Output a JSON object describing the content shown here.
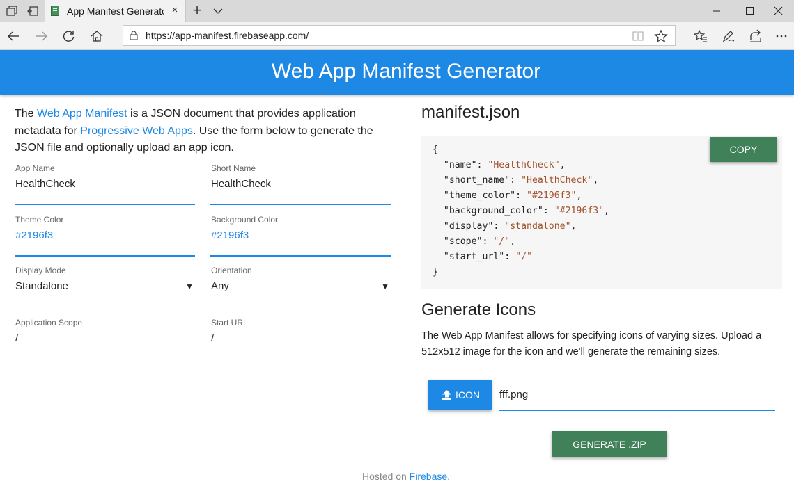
{
  "browser": {
    "tab_title": "App Manifest Generator",
    "url": "https://app-manifest.firebaseapp.com/",
    "new_tab_label": "+",
    "close_tab_label": "×"
  },
  "header": {
    "title": "Web App Manifest Generator"
  },
  "intro": {
    "t1": "The ",
    "link1": "Web App Manifest",
    "t2": " is a JSON document that provides application metadata for ",
    "link2": "Progressive Web Apps",
    "t3": ". Use the form below to generate the JSON file and optionally upload an app icon."
  },
  "form": {
    "app_name": {
      "label": "App Name",
      "value": "HealthCheck"
    },
    "short_name": {
      "label": "Short Name",
      "value": "HealthCheck"
    },
    "theme_color": {
      "label": "Theme Color",
      "value": "#2196f3"
    },
    "background_color": {
      "label": "Background Color",
      "value": "#2196f3"
    },
    "display_mode": {
      "label": "Display Mode",
      "value": "Standalone",
      "arrow": "▼"
    },
    "orientation": {
      "label": "Orientation",
      "value": "Any",
      "arrow": "▼"
    },
    "app_scope": {
      "label": "Application Scope",
      "value": "/"
    },
    "start_url": {
      "label": "Start URL",
      "value": "/"
    }
  },
  "manifest": {
    "title": "manifest.json",
    "copy_label": "COPY",
    "open_brace": "{",
    "close_brace": "}",
    "entries": [
      {
        "key": "\"name\"",
        "value": "\"HealthCheck\"",
        "sep": ","
      },
      {
        "key": "\"short_name\"",
        "value": "\"HealthCheck\"",
        "sep": ","
      },
      {
        "key": "\"theme_color\"",
        "value": "\"#2196f3\"",
        "sep": ","
      },
      {
        "key": "\"background_color\"",
        "value": "\"#2196f3\"",
        "sep": ","
      },
      {
        "key": "\"display\"",
        "value": "\"standalone\"",
        "sep": ","
      },
      {
        "key": "\"scope\"",
        "value": "\"/\"",
        "sep": ","
      },
      {
        "key": "\"start_url\"",
        "value": "\"/\"",
        "sep": ""
      }
    ]
  },
  "icons": {
    "title": "Generate Icons",
    "description": "The Web App Manifest allows for specifying icons of varying sizes. Upload a 512x512 image for the icon and we'll generate the remaining sizes.",
    "icon_button_label": "ICON",
    "file_name": "fff.png",
    "generate_label": "GENERATE .ZIP"
  },
  "footer": {
    "text": "Hosted on ",
    "link": "Firebase",
    "end": "."
  },
  "colors": {
    "primary": "#1e88e5",
    "accent": "#41815a"
  }
}
